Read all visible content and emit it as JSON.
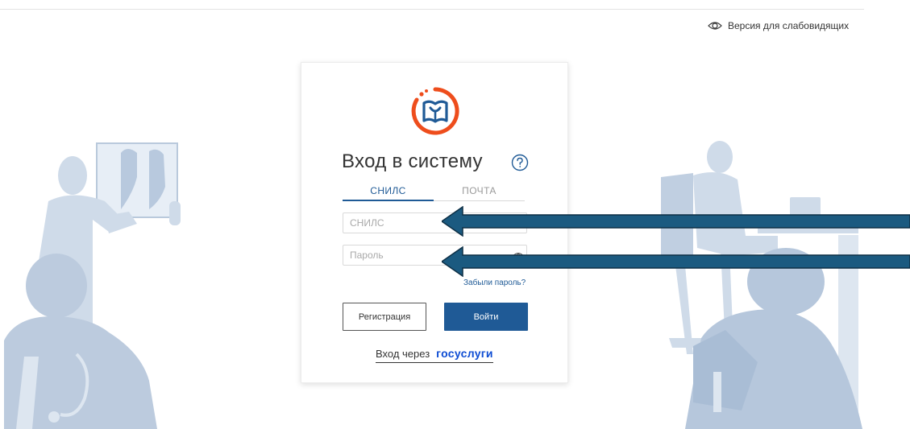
{
  "header": {
    "accessibility_label": "Версия для слабовидящих"
  },
  "login": {
    "title": "Вход в систему",
    "tabs": [
      {
        "label": "СНИЛС",
        "active": true
      },
      {
        "label": "ПОЧТА",
        "active": false
      }
    ],
    "snils_placeholder": "СНИЛС",
    "password_placeholder": "Пароль",
    "forgot_password": "Забыли пароль?",
    "register_label": "Регистрация",
    "login_label": "Войти",
    "gosuslugi_prefix": "Вход через",
    "gosuslugi_brand_part1": "гос",
    "gosuslugi_brand_part2": "услуги"
  },
  "colors": {
    "primary": "#1f5a96",
    "logo_orange": "#ee4d1c",
    "logo_blue": "#1f5a96",
    "illustration": "#c9d6e6",
    "arrow": "#1b5a80"
  },
  "icons": [
    "eye-icon",
    "help-circle-icon",
    "password-eye-icon",
    "app-logo-icon"
  ]
}
